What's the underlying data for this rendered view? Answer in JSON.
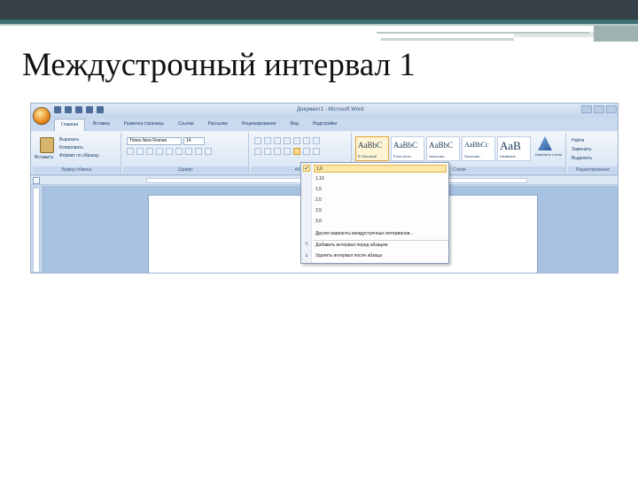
{
  "slide": {
    "title": "Междустрочный интервал 1"
  },
  "word": {
    "window_title": "Документ1 - Microsoft Word",
    "tabs": [
      {
        "label": "Главная",
        "active": true
      },
      {
        "label": "Вставка",
        "active": false
      },
      {
        "label": "Разметка страницы",
        "active": false
      },
      {
        "label": "Ссылки",
        "active": false
      },
      {
        "label": "Рассылки",
        "active": false
      },
      {
        "label": "Рецензирование",
        "active": false
      },
      {
        "label": "Вид",
        "active": false
      },
      {
        "label": "Надстройки",
        "active": false
      }
    ],
    "clipboard": {
      "paste_label": "Вставить",
      "cut_label": "Вырезать",
      "copy_label": "Копировать",
      "format_painter_label": "Формат по образцу",
      "group_label": "Буфер обмена"
    },
    "font": {
      "font_name": "Times New Roman",
      "font_size": "14",
      "group_label": "Шрифт"
    },
    "paragraph": {
      "group_label": "Абзац"
    },
    "styles": {
      "items": [
        {
          "sample": "AaBbC",
          "name": "¶ Обычный",
          "selected": true
        },
        {
          "sample": "AaBbC",
          "name": "¶ Без инте...",
          "selected": false
        },
        {
          "sample": "AaBbC",
          "name": "Заголово...",
          "selected": false
        },
        {
          "sample": "AaBbCc",
          "name": "Заголово...",
          "selected": false
        },
        {
          "sample": "AaB",
          "name": "Название",
          "selected": false
        }
      ],
      "change_styles_label": "Изменить стили",
      "group_label": "Стили"
    },
    "editing": {
      "find_label": "Найти",
      "replace_label": "Заменить",
      "select_label": "Выделить",
      "group_label": "Редактирование"
    },
    "line_spacing_menu": {
      "options": [
        {
          "label": "1,0",
          "checked": true
        },
        {
          "label": "1,15",
          "checked": false
        },
        {
          "label": "1,5",
          "checked": false
        },
        {
          "label": "2,0",
          "checked": false
        },
        {
          "label": "2,5",
          "checked": false
        },
        {
          "label": "3,0",
          "checked": false
        }
      ],
      "other_options_label": "Другие варианты междустрочных интервалов...",
      "add_before_label": "Добавить интервал перед абзацем",
      "remove_after_label": "Удалить интервал после абзаца"
    }
  }
}
